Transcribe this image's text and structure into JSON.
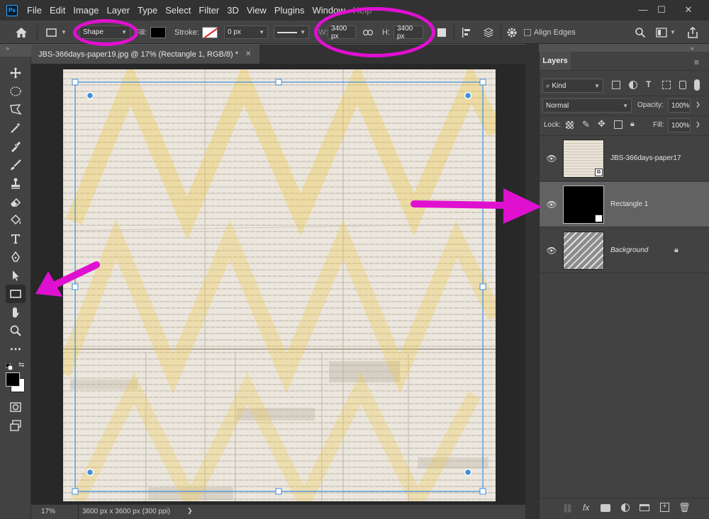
{
  "app": {
    "logo": "Ps",
    "menu": [
      "File",
      "Edit",
      "Image",
      "Layer",
      "Type",
      "Select",
      "Filter",
      "3D",
      "View",
      "Plugins",
      "Window",
      "Help"
    ],
    "window_controls": {
      "minimize": "—",
      "maximize": "☐",
      "close": "✕"
    }
  },
  "options_bar": {
    "tool_mode": "Shape",
    "fill_label": "Fill:",
    "stroke_label": "Stroke:",
    "stroke_width": "0 px",
    "w_label": "W:",
    "w_value": "3400 px",
    "h_label": "H:",
    "h_value": "3400 px",
    "align_edges_label": "Align Edges",
    "fill_color": "#000000"
  },
  "document": {
    "tab_title": "JBS-366days-paper19.jpg @ 17% (Rectangle 1, RGB/8) *",
    "close": "✕",
    "zoom": "17%",
    "doc_info": "3600 px x 3600 px (300 ppi)",
    "status_arrow": "❯"
  },
  "layers_panel": {
    "title": "Layers",
    "filter_kind": "Kind",
    "blend_mode": "Normal",
    "opacity_label": "Opacity:",
    "opacity_value": "100%",
    "lock_label": "Lock:",
    "fill_label": "Fill:",
    "fill_value": "100%",
    "layers": [
      {
        "name": "JBS-366days-paper17",
        "thumb": "paper",
        "visible": true,
        "selected": false
      },
      {
        "name": "Rectangle 1",
        "thumb": "black",
        "visible": true,
        "selected": true
      },
      {
        "name": "Background",
        "thumb": "striped",
        "visible": true,
        "selected": false,
        "locked": true
      }
    ]
  },
  "colors": {
    "annotation_pink": "#e010d0",
    "selection_blue": "#3d8fe0",
    "foreground": "#000000",
    "background": "#ffffff"
  }
}
